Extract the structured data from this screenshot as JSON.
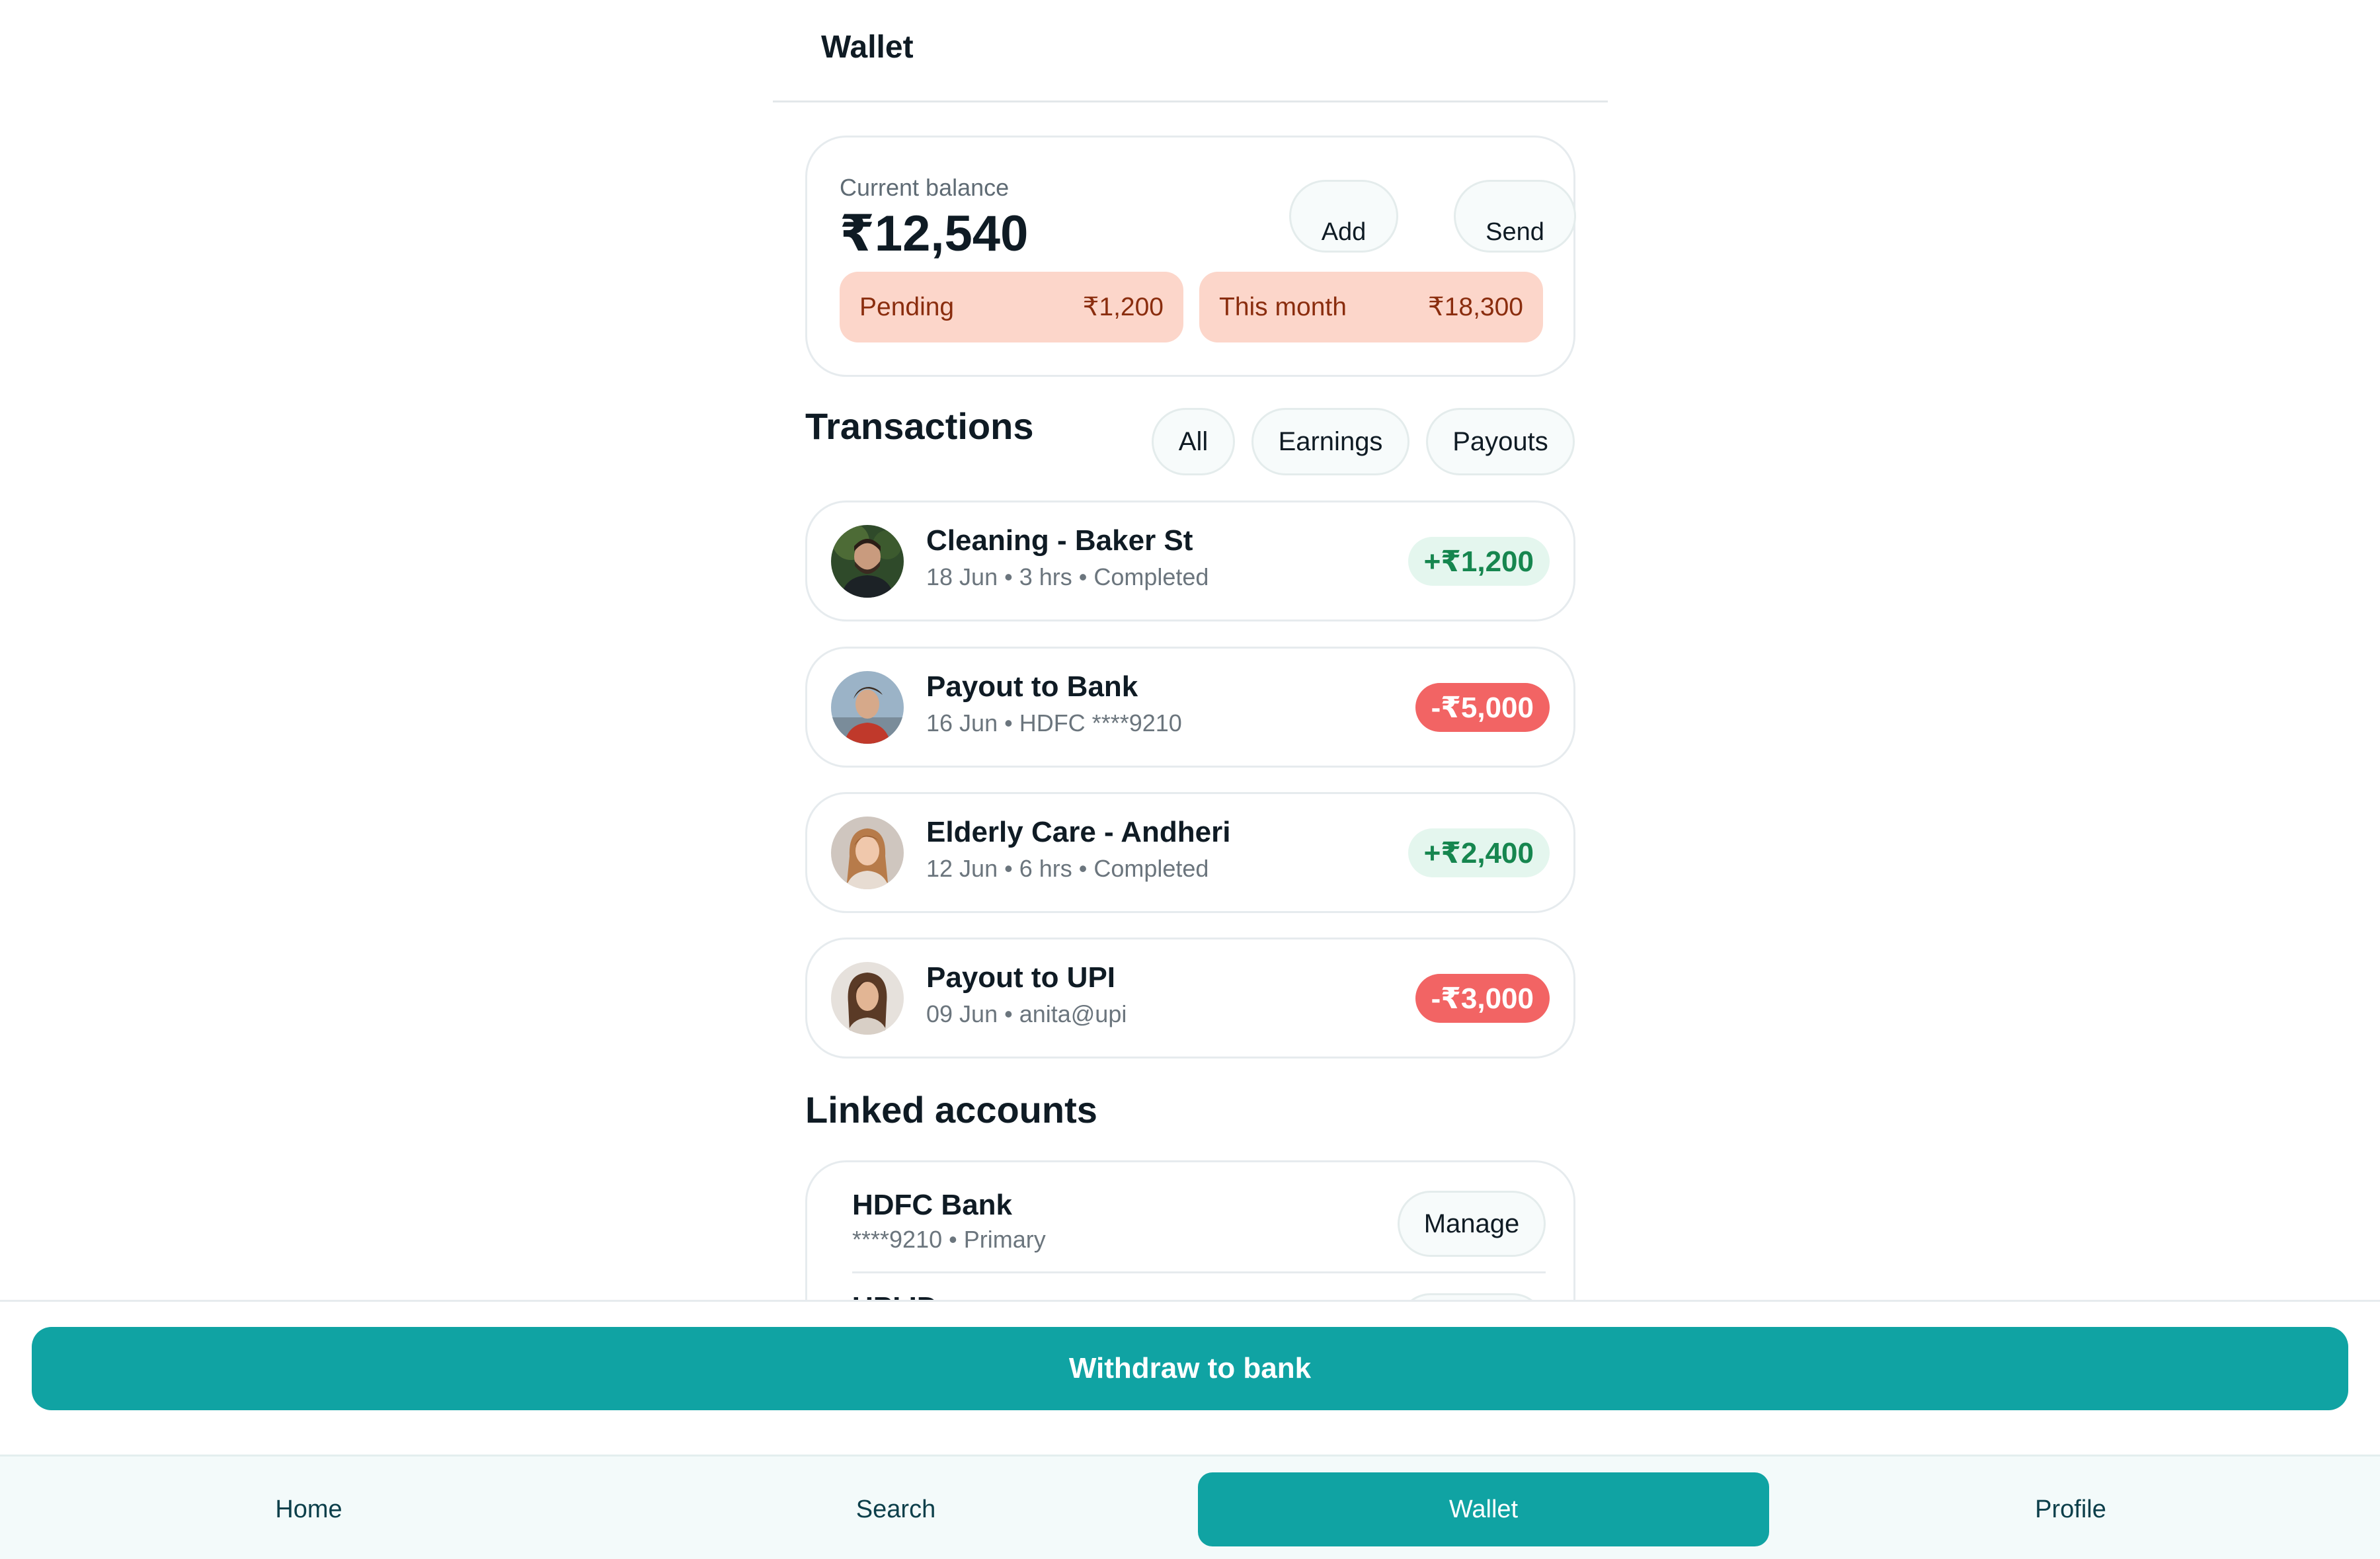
{
  "header": {
    "title": "Wallet"
  },
  "balance": {
    "label": "Current balance",
    "value": "₹12,540",
    "add_label": "Add",
    "send_label": "Send",
    "pending_label": "Pending",
    "pending_value": "₹1,200",
    "month_label": "This month",
    "month_value": "₹18,300"
  },
  "transactions": {
    "title": "Transactions",
    "filters": [
      "All",
      "Earnings",
      "Payouts"
    ],
    "items": [
      {
        "name": "Cleaning - Baker St",
        "meta": "18 Jun • 3 hrs • Completed",
        "amount": "+₹1,200",
        "type": "credit"
      },
      {
        "name": "Payout to Bank",
        "meta": "16 Jun • HDFC ****9210",
        "amount": "-₹5,000",
        "type": "debit"
      },
      {
        "name": "Elderly Care - Andheri",
        "meta": "12 Jun • 6 hrs • Completed",
        "amount": "+₹2,400",
        "type": "credit"
      },
      {
        "name": "Payout to UPI",
        "meta": "09 Jun • anita@upi",
        "amount": "-₹3,000",
        "type": "debit"
      }
    ]
  },
  "linked": {
    "title": "Linked accounts",
    "accounts": [
      {
        "name": "HDFC Bank",
        "meta": "****9210 • Primary",
        "action": "Manage"
      },
      {
        "name": "UPI ID"
      }
    ]
  },
  "actions": {
    "withdraw_label": "Withdraw to bank"
  },
  "nav": {
    "items": [
      "Home",
      "Search",
      "Wallet",
      "Profile"
    ],
    "active": "Wallet"
  },
  "colors": {
    "accent": "#10a3a3",
    "credit_bg": "#e4f6ee",
    "credit_text": "#16864f",
    "debit_bg": "#f26464",
    "stat_bg": "#fcd6ca",
    "stat_text": "#8a2d0e"
  },
  "icons": [
    "avatar-male-beard",
    "avatar-male-young",
    "avatar-female-blonde",
    "avatar-female-brunette"
  ]
}
